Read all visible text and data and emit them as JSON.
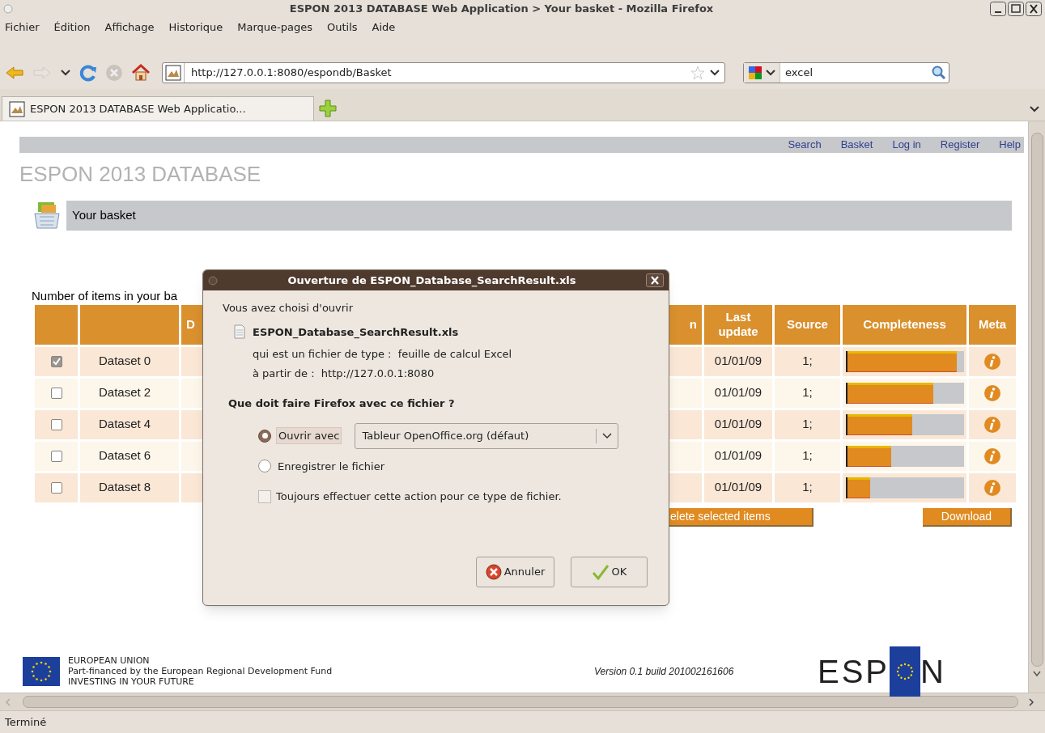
{
  "window": {
    "title": "ESPON 2013 DATABASE Web Application > Your basket - Mozilla Firefox"
  },
  "menu": [
    {
      "label": "Fichier"
    },
    {
      "label": "Édition"
    },
    {
      "label": "Affichage"
    },
    {
      "label": "Historique"
    },
    {
      "label": "Marque-pages"
    },
    {
      "label": "Outils"
    },
    {
      "label": "Aide"
    }
  ],
  "address_bar": {
    "value": "http://127.0.0.1:8080/espondb/Basket"
  },
  "search_bar": {
    "value": "excel"
  },
  "tabs": [
    {
      "label": "ESPON 2013 DATABASE Web Applicatio...",
      "selected": true
    }
  ],
  "site_nav": [
    "Search",
    "Basket",
    "Log in",
    "Register",
    "Help"
  ],
  "site_title": "ESPON 2013 DATABASE",
  "section_title": "Your basket",
  "items_count_label": "Number of items in your ba",
  "table": {
    "columns": [
      "",
      "",
      "D",
      "n",
      "Last update",
      "Source",
      "Completeness",
      "Meta"
    ],
    "rows": [
      {
        "checked": true,
        "name": "Dataset 0",
        "last_update": "01/01/09",
        "source": "1;",
        "level": 0.94
      },
      {
        "checked": false,
        "name": "Dataset 2",
        "last_update": "01/01/09",
        "source": "1;",
        "level": 0.74
      },
      {
        "checked": false,
        "name": "Dataset 4",
        "last_update": "01/01/09",
        "source": "1;",
        "level": 0.56
      },
      {
        "checked": false,
        "name": "Dataset 6",
        "last_update": "01/01/09",
        "source": "1;",
        "level": 0.38
      },
      {
        "checked": false,
        "name": "Dataset 8",
        "last_update": "01/01/09",
        "source": "1;",
        "level": 0.2
      }
    ]
  },
  "table_buttons": [
    "elete selected items",
    "Download"
  ],
  "footer": {
    "eu_lines": [
      "EUROPEAN UNION",
      "Part-financed by the European Regional Development Fund",
      "INVESTING IN YOUR FUTURE"
    ],
    "version": "Version 0.1 build 201002161606",
    "logo_letters": "ESP",
    "logo_end": "N"
  },
  "status_bar": "Terminé",
  "dialog": {
    "title": "Ouverture de ESPON_Database_SearchResult.xls",
    "intro": "Vous avez choisi d'ouvrir",
    "filename": "ESPON_Database_SearchResult.xls",
    "type_line": "qui est un fichier de type :  feuille de calcul Excel",
    "from_line": "à partir de :  http://127.0.0.1:8080",
    "question": "Que doit faire Firefox avec ce fichier ?",
    "options": [
      {
        "label": "Ouvrir avec",
        "selected": true
      },
      {
        "label": "Enregistrer le fichier",
        "selected": false
      }
    ],
    "app_select": {
      "value": "Tableur OpenOffice.org (défaut)"
    },
    "always": {
      "label": "Toujours effectuer cette action pour ce type de fichier.",
      "checked": false
    },
    "buttons": [
      "Annuler",
      "OK"
    ]
  }
}
